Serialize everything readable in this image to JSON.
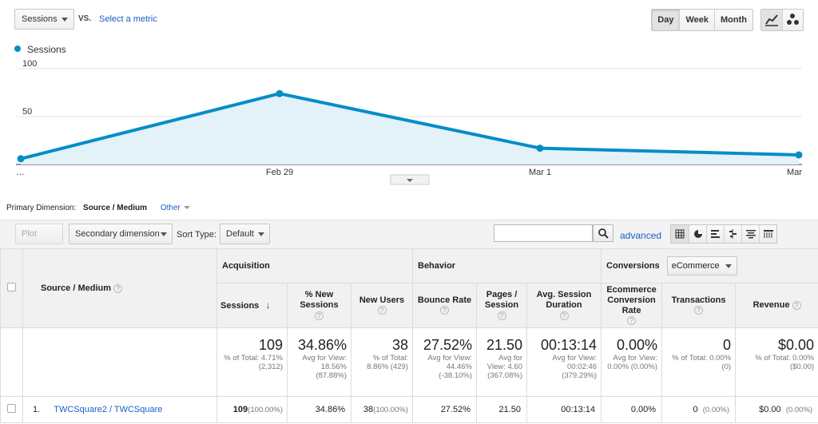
{
  "toolbar": {
    "metric": "Sessions",
    "vs": "VS.",
    "select_metric": "Select a metric",
    "periods": [
      "Day",
      "Week",
      "Month"
    ]
  },
  "legend": {
    "series": "Sessions"
  },
  "chart_data": {
    "type": "area",
    "x": [
      "…",
      "Feb 29",
      "Mar 1",
      "Mar"
    ],
    "series": [
      {
        "name": "Sessions",
        "values": [
          6,
          74,
          17,
          10
        ]
      }
    ],
    "yticks": [
      50,
      100
    ],
    "ylim": [
      0,
      100
    ],
    "color": "#058dc7",
    "fill": "#e3f1f9"
  },
  "dimension": {
    "label": "Primary Dimension:",
    "active": "Source / Medium",
    "other": "Other"
  },
  "table_toolbar": {
    "plot_rows": "Plot Rows",
    "secondary": "Secondary dimension",
    "sort_type_label": "Sort Type:",
    "sort_type": "Default",
    "advanced": "advanced"
  },
  "table": {
    "dimension_header": "Source / Medium",
    "groups": {
      "acquisition": "Acquisition",
      "behavior": "Behavior",
      "conversions": "Conversions",
      "conversions_select": "eCommerce"
    },
    "columns": {
      "sessions": "Sessions",
      "new_sessions": "% New Sessions",
      "new_users": "New Users",
      "bounce_rate": "Bounce Rate",
      "pages_session": "Pages / Session",
      "avg_duration": "Avg. Session Duration",
      "ecom_rate": "Ecommerce Conversion Rate",
      "transactions": "Transactions",
      "revenue": "Revenue"
    },
    "totals": {
      "sessions": {
        "value": "109",
        "sub": "% of Total: 4.71% (2,312)"
      },
      "new_sessions": {
        "value": "34.86%",
        "sub": "Avg for View: 18.56% (87.88%)"
      },
      "new_users": {
        "value": "38",
        "sub": "% of Total: 8.86% (429)"
      },
      "bounce_rate": {
        "value": "27.52%",
        "sub": "Avg for View: 44.46% (-38.10%)"
      },
      "pages_session": {
        "value": "21.50",
        "sub": "Avg for View: 4.60 (367.08%)"
      },
      "avg_duration": {
        "value": "00:13:14",
        "sub": "Avg for View: 00:02:46 (379.29%)"
      },
      "ecom_rate": {
        "value": "0.00%",
        "sub": "Avg for View: 0.00% (0.00%)"
      },
      "transactions": {
        "value": "0",
        "sub": "% of Total: 0.00% (0)"
      },
      "revenue": {
        "value": "$0.00",
        "sub": "% of Total: 0.00% ($0.00)"
      }
    },
    "rows": [
      {
        "index": "1.",
        "source": "TWCSquare2 / TWCSquare",
        "sessions": "109",
        "sessions_pct": "(100.00%)",
        "new_sessions": "34.86%",
        "new_users": "38",
        "new_users_pct": "(100.00%)",
        "bounce_rate": "27.52%",
        "pages_session": "21.50",
        "avg_duration": "00:13:14",
        "ecom_rate": "0.00%",
        "transactions": "0",
        "transactions_pct": "(0.00%)",
        "revenue": "$0.00",
        "revenue_pct": "(0.00%)"
      }
    ]
  }
}
